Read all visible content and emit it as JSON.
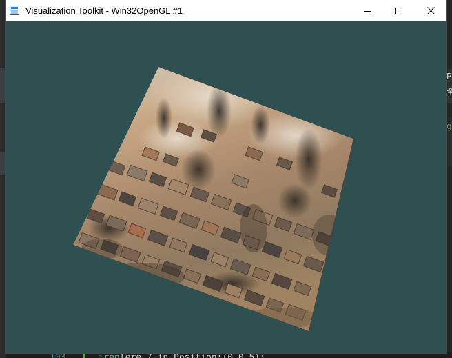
{
  "window": {
    "title": "Visualization Toolkit - Win32OpenGL #1",
    "background_color": "#2f5050",
    "controls": {
      "minimize_icon": "minimize-icon",
      "maximize_icon": "maximize-icon",
      "close_icon": "close-icon"
    }
  },
  "render": {
    "object": "texture-mapped-plane",
    "texture": "weathered-stone-wall",
    "texture_palette": [
      "#c9a27a",
      "#8a6a4a",
      "#5a4a3a",
      "#3a3330",
      "#d8cdb8",
      "#a05a3a"
    ]
  },
  "background_editor": {
    "line_number": "103",
    "code_fragment": "iren",
    "code_text": "lere 7 in Position:(0.0.5);",
    "right_chars": [
      "P",
      "全",
      "g"
    ]
  }
}
